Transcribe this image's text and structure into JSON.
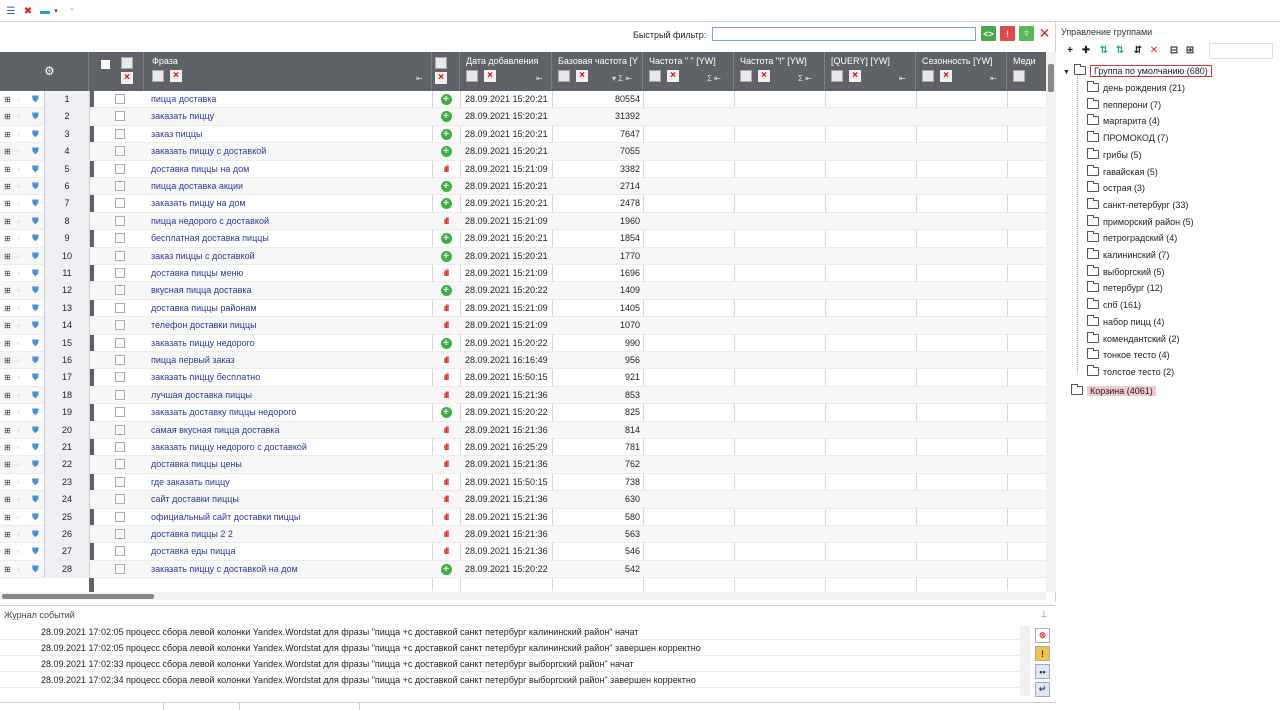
{
  "colors": {
    "header_bg": "#5f6368",
    "phrase_link": "#2a3a9c",
    "plus_green": "#3cb043",
    "bars_red": "#e02020",
    "basket_highlight": "#f5c9cf",
    "default_group_border": "#dd3333"
  },
  "toolbar": {
    "icons": [
      "list-icon",
      "delete-icon",
      "export-icon",
      "dropdown-icon"
    ]
  },
  "filter": {
    "label": "Быстрый фильтр:",
    "value": "",
    "buttons": [
      "code-icon",
      "exclamation-icon",
      "filter-icon",
      "close-icon"
    ]
  },
  "grid": {
    "columns": [
      {
        "title": "Фраза"
      },
      {
        "title": "Дата добавления"
      },
      {
        "title": "Базовая частота [Y"
      },
      {
        "title": "Частота \" \" [YW]"
      },
      {
        "title": "Частота \"!\" [YW]"
      },
      {
        "title": "[QUERY] [YW]"
      },
      {
        "title": "Сезонность [YW]"
      },
      {
        "title": "Меди"
      }
    ],
    "rows": [
      {
        "n": "1",
        "phrase": "пицца доставка",
        "status": "plus",
        "date": "28.09.2021 15:20:21",
        "freq": "80554"
      },
      {
        "n": "2",
        "phrase": "заказать пиццу",
        "status": "plus",
        "date": "28.09.2021 15:20:21",
        "freq": "31392"
      },
      {
        "n": "3",
        "phrase": "заказ пиццы",
        "status": "plus",
        "date": "28.09.2021 15:20:21",
        "freq": "7647"
      },
      {
        "n": "4",
        "phrase": "заказать пиццу с доставкой",
        "status": "plus",
        "date": "28.09.2021 15:20:21",
        "freq": "7055"
      },
      {
        "n": "5",
        "phrase": "доставка пиццы на дом",
        "status": "bars",
        "date": "28.09.2021 15:21:09",
        "freq": "3382"
      },
      {
        "n": "6",
        "phrase": "пицца доставка акции",
        "status": "plus",
        "date": "28.09.2021 15:20:21",
        "freq": "2714"
      },
      {
        "n": "7",
        "phrase": "заказать пиццу на дом",
        "status": "plus",
        "date": "28.09.2021 15:20:21",
        "freq": "2478"
      },
      {
        "n": "8",
        "phrase": "пицца недорого с доставкой",
        "status": "bars",
        "date": "28.09.2021 15:21:09",
        "freq": "1960"
      },
      {
        "n": "9",
        "phrase": "бесплатная доставка пиццы",
        "status": "plus",
        "date": "28.09.2021 15:20:21",
        "freq": "1854"
      },
      {
        "n": "10",
        "phrase": "заказ пиццы с доставкой",
        "status": "plus",
        "date": "28.09.2021 15:20:21",
        "freq": "1770"
      },
      {
        "n": "11",
        "phrase": "доставка пиццы меню",
        "status": "bars",
        "date": "28.09.2021 15:21:09",
        "freq": "1696"
      },
      {
        "n": "12",
        "phrase": "вкусная пицца доставка",
        "status": "plus",
        "date": "28.09.2021 15:20:22",
        "freq": "1409"
      },
      {
        "n": "13",
        "phrase": "доставка пиццы районам",
        "status": "bars",
        "date": "28.09.2021 15:21:09",
        "freq": "1405"
      },
      {
        "n": "14",
        "phrase": "телефон доставки пиццы",
        "status": "bars",
        "date": "28.09.2021 15:21:09",
        "freq": "1070"
      },
      {
        "n": "15",
        "phrase": "заказать пиццу недорого",
        "status": "plus",
        "date": "28.09.2021 15:20:22",
        "freq": "990"
      },
      {
        "n": "16",
        "phrase": "пицца первый заказ",
        "status": "bars",
        "date": "28.09.2021 16:16:49",
        "freq": "956"
      },
      {
        "n": "17",
        "phrase": "заказать пиццу бесплатно",
        "status": "bars",
        "date": "28.09.2021 15:50:15",
        "freq": "921"
      },
      {
        "n": "18",
        "phrase": "лучшая доставка пиццы",
        "status": "bars",
        "date": "28.09.2021 15:21:36",
        "freq": "853"
      },
      {
        "n": "19",
        "phrase": "заказать доставку пиццы недорого",
        "status": "plus",
        "date": "28.09.2021 15:20:22",
        "freq": "825"
      },
      {
        "n": "20",
        "phrase": "самая вкусная пицца доставка",
        "status": "bars",
        "date": "28.09.2021 15:21:36",
        "freq": "814"
      },
      {
        "n": "21",
        "phrase": "заказать пиццу недорого с доставкой",
        "status": "bars",
        "date": "28.09.2021 16:25:29",
        "freq": "781"
      },
      {
        "n": "22",
        "phrase": "доставка пиццы цены",
        "status": "bars",
        "date": "28.09.2021 15:21:36",
        "freq": "762"
      },
      {
        "n": "23",
        "phrase": "где заказать пиццу",
        "status": "bars",
        "date": "28.09.2021 15:50:15",
        "freq": "738"
      },
      {
        "n": "24",
        "phrase": "сайт доставки пиццы",
        "status": "bars",
        "date": "28.09.2021 15:21:36",
        "freq": "630"
      },
      {
        "n": "25",
        "phrase": "официальный сайт доставки пиццы",
        "status": "bars",
        "date": "28.09.2021 15:21:36",
        "freq": "580"
      },
      {
        "n": "26",
        "phrase": "доставка пиццы 2 2",
        "status": "bars",
        "date": "28.09.2021 15:21:36",
        "freq": "563"
      },
      {
        "n": "27",
        "phrase": "доставка еды пицца",
        "status": "bars",
        "date": "28.09.2021 15:21:36",
        "freq": "546"
      },
      {
        "n": "28",
        "phrase": "заказать пиццу с доставкой на дом",
        "status": "plus",
        "date": "28.09.2021 15:20:22",
        "freq": "542"
      }
    ]
  },
  "log": {
    "title": "Журнал событий",
    "entries": [
      {
        "ts": "28.09.2021 17:02:05",
        "msg": "процесс сбора левой колонки Yandex.Wordstat для фразы \"пицца +с доставкой санкт петербург калининский район\" начат"
      },
      {
        "ts": "28.09.2021 17:02:05",
        "msg": "процесс сбора левой колонки Yandex.Wordstat для фразы \"пицца +с доставкой санкт петербург калининский район\" завершен корректно"
      },
      {
        "ts": "28.09.2021 17:02:33",
        "msg": "процесс сбора левой колонки Yandex.Wordstat для фразы \"пицца +с доставкой санкт петербург выборгский район\" начат"
      },
      {
        "ts": "28.09.2021 17:02:34",
        "msg": "процесс сбора левой колонки Yandex.Wordstat для фразы \"пицца +с доставкой санкт петербург выборгский район\" завершен корректно"
      }
    ]
  },
  "groups": {
    "title": "Управление группами",
    "default_group": "Группа по умолчанию (680)",
    "children": [
      "день рождения (21)",
      "пепперони (7)",
      "маргарита (4)",
      "ПРОМОКОД (7)",
      "грибы (5)",
      "гавайская (5)",
      "острая (3)",
      "санкт-петербург (33)",
      "приморский район (5)",
      "петроградский (4)",
      "калининский (7)",
      "выборгский (5)",
      "петербург (12)",
      "спб (161)",
      "набор пицц (4)",
      "комендантский (2)",
      "тонкое тесто (4)",
      "толстое тесто (2)"
    ],
    "basket": "Корзина (4061)"
  }
}
